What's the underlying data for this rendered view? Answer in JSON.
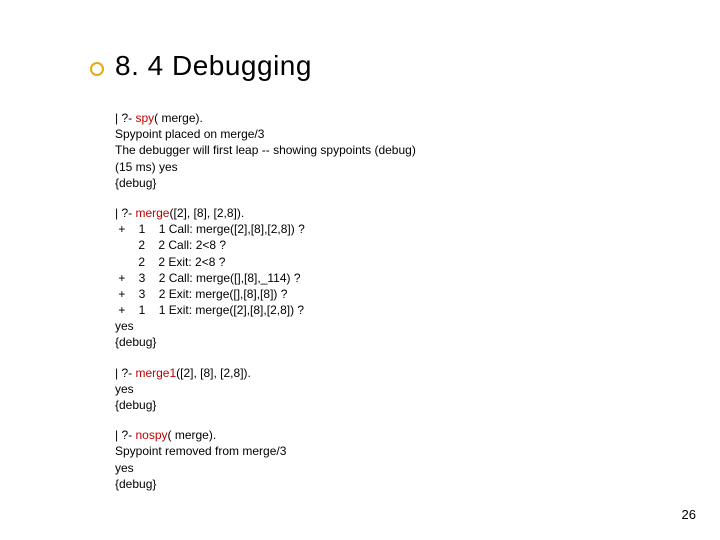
{
  "title": "8. 4 Debugging",
  "block1": {
    "prefix": "| ?- ",
    "cmd": "spy",
    "rest": "( merge).\nSpypoint placed on merge/3\nThe debugger will first leap -- showing spypoints (debug)\n(15 ms) yes\n{debug}"
  },
  "block2": {
    "prefix": "| ?- ",
    "cmd": "merge",
    "rest": "([2], [8], [2,8]).\n +    1    1 Call: merge([2],[8],[2,8]) ?\n       2    2 Call: 2<8 ?\n       2    2 Exit: 2<8 ?\n +    3    2 Call: merge([],[8],_114) ?\n +    3    2 Exit: merge([],[8],[8]) ?\n +    1    1 Exit: merge([2],[8],[2,8]) ?\nyes\n{debug}"
  },
  "block3": {
    "prefix": "| ?- ",
    "cmd": "merge1",
    "rest": "([2], [8], [2,8]).\nyes\n{debug}"
  },
  "block4": {
    "prefix": "| ?- ",
    "cmd": "nospy",
    "rest": "( merge).\nSpypoint removed from merge/3\nyes\n{debug}"
  },
  "pagenum": "26"
}
